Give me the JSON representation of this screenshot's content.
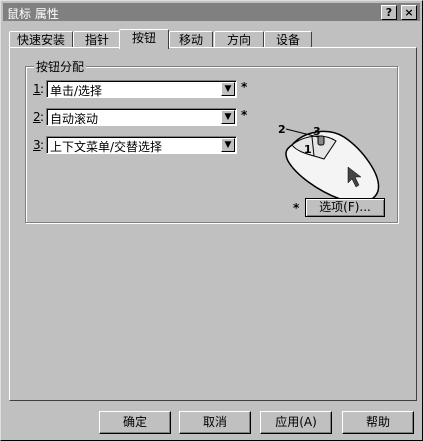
{
  "window": {
    "title": "鼠标 属性",
    "help_btn": "?",
    "close_btn": "×"
  },
  "tabs": [
    "快速安装",
    "指针",
    "按钮",
    "移动",
    "方向",
    "设备"
  ],
  "active_tab": "按钮",
  "group": {
    "title": "按钮分配",
    "rows": [
      {
        "num": "1",
        "colon": ":",
        "value": "单击/选择",
        "star": "*"
      },
      {
        "num": "2",
        "colon": ":",
        "value": "自动滚动",
        "star": "*"
      },
      {
        "num": "3",
        "colon": ":",
        "value": "上下文菜单/交替选择",
        "star": ""
      }
    ],
    "arrow_glyph": "▼",
    "mouse_labels": {
      "b1": "1",
      "b2": "2",
      "b3": "3"
    },
    "options_star": "*",
    "options_label": "选项(F)..."
  },
  "buttons": {
    "ok": "确定",
    "cancel": "取消",
    "apply": "应用(A)",
    "help": "帮助"
  }
}
